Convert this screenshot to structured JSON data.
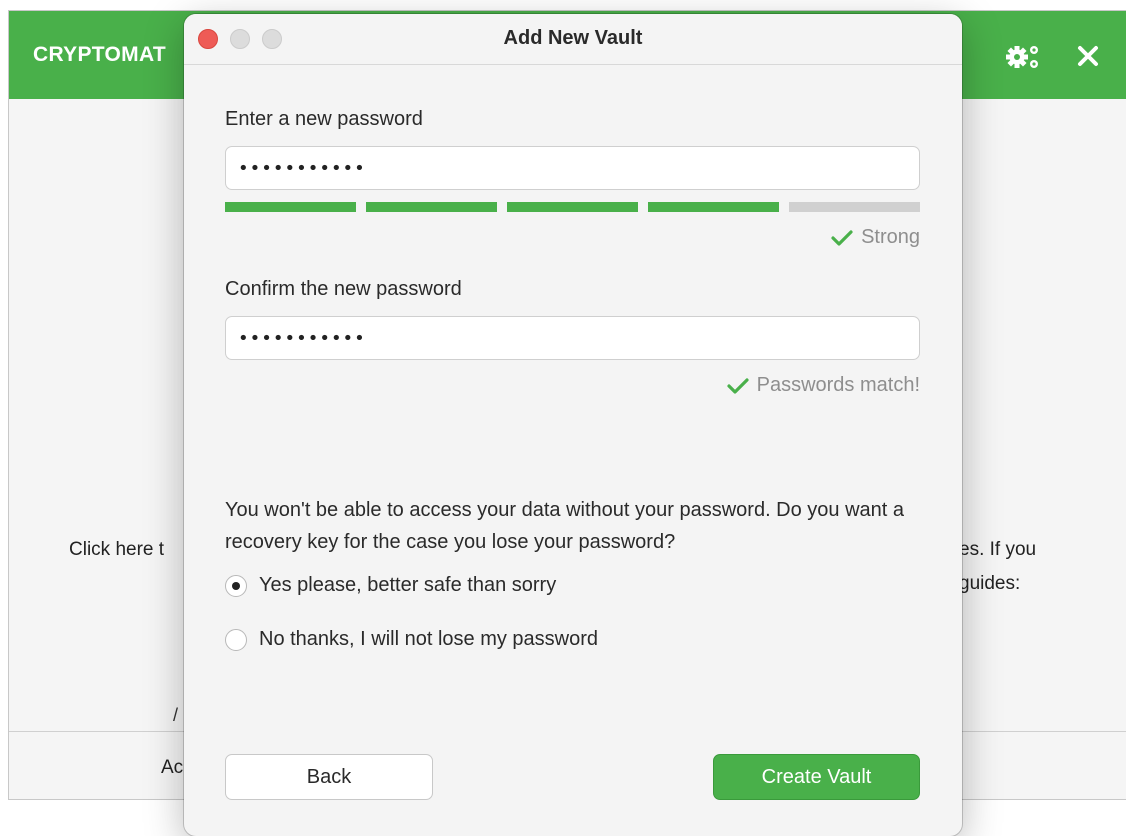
{
  "main_window": {
    "app_title": "CRYPTOMAT",
    "body_text_left": "Click here t",
    "body_text_right_line1": "es. If you",
    "body_text_right_line2": "guides:",
    "footer_text": "Ac",
    "slash": "/",
    "settings_icon": "gear-icon",
    "close_icon": "close-icon",
    "header_color": "#49b04a"
  },
  "dialog": {
    "title": "Add New Vault",
    "new_password": {
      "label": "Enter a new password",
      "value": "•••••••••••"
    },
    "strength": {
      "segments_total": 5,
      "segments_filled": 4,
      "filled_color": "#49b04a",
      "empty_color": "#d0d0d0",
      "status_text": "Strong"
    },
    "confirm_password": {
      "label": "Confirm the new password",
      "value": "•••••••••••",
      "status_text": "Passwords match!"
    },
    "recovery": {
      "question": "You won't be able to access your data without your password. Do you want a recovery key for the case you lose your password?",
      "options": [
        {
          "label": "Yes please, better safe than sorry",
          "selected": true
        },
        {
          "label": "No thanks, I will not lose my password",
          "selected": false
        }
      ]
    },
    "buttons": {
      "back_label": "Back",
      "create_label": "Create Vault"
    }
  }
}
